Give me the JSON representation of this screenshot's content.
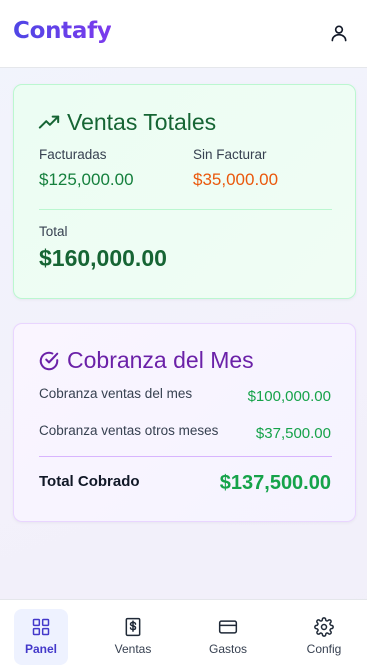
{
  "header": {
    "app_name": "Contafy",
    "user_icon": "user-icon"
  },
  "ventas": {
    "title": "Ventas Totales",
    "icon": "trending-up-icon",
    "facturadas_label": "Facturadas",
    "facturadas_value": "$125,000.00",
    "sin_facturar_label": "Sin Facturar",
    "sin_facturar_value": "$35,000.00",
    "total_label": "Total",
    "total_value": "$160,000.00"
  },
  "cobranza": {
    "title": "Cobranza del Mes",
    "icon": "check-circle-icon",
    "rows": [
      {
        "label": "Cobranza ventas del mes",
        "value": "$100,000.00"
      },
      {
        "label": "Cobranza ventas otros meses",
        "value": "$37,500.00"
      }
    ],
    "total_label": "Total Cobrado",
    "total_value": "$137,500.00"
  },
  "nav": {
    "items": [
      {
        "label": "Panel",
        "icon": "grid-icon",
        "active": true
      },
      {
        "label": "Ventas",
        "icon": "dollar-receipt-icon",
        "active": false
      },
      {
        "label": "Gastos",
        "icon": "credit-card-icon",
        "active": false
      },
      {
        "label": "Config",
        "icon": "gear-icon",
        "active": false
      }
    ]
  },
  "colors": {
    "brand_start": "#4f46e5",
    "brand_end": "#7c3aed",
    "green_dark": "#166534",
    "green": "#15803d",
    "orange": "#ea580c",
    "purple": "#6b21a8",
    "green_bright": "#16a34a"
  }
}
